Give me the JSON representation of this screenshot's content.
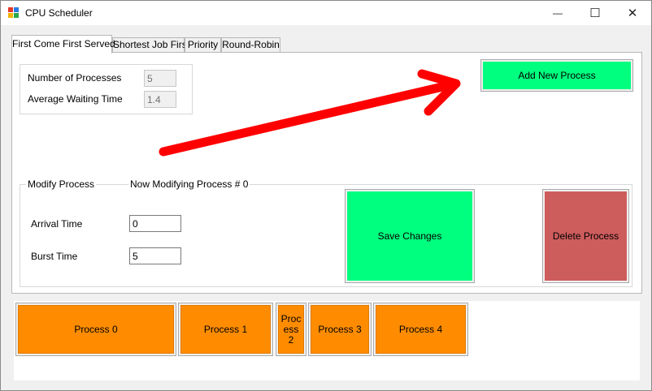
{
  "window": {
    "title": "CPU Scheduler",
    "icon": "app-window-icon",
    "controls": {
      "minimize": "—",
      "maximize": "☐",
      "close": "✕"
    }
  },
  "tabs": [
    {
      "label": "First Come First Served",
      "active": true
    },
    {
      "label": "Shortest Job First",
      "active": false
    },
    {
      "label": "Priority",
      "active": false
    },
    {
      "label": "Round-Robin",
      "active": false
    }
  ],
  "stats": {
    "num_processes_label": "Number of Processes",
    "num_processes_value": "5",
    "avg_wait_label": "Average Waiting Time",
    "avg_wait_value": "1.4"
  },
  "add_button": {
    "label": "Add New Process",
    "color": "#00ff7f"
  },
  "modify": {
    "group_title": "Modify Process",
    "status": "Now Modifying Process # 0",
    "arrival_label": "Arrival Time",
    "arrival_value": "0",
    "burst_label": "Burst Time",
    "burst_value": "5",
    "save_label": "Save Changes",
    "save_color": "#00ff7f",
    "delete_label": "Delete Process",
    "delete_color": "#cd5c5c"
  },
  "processes": [
    {
      "label": "Process 0",
      "color": "#ff8c00"
    },
    {
      "label": "Process 1",
      "color": "#ff8c00"
    },
    {
      "label": "Proc ess 2",
      "color": "#ff8c00"
    },
    {
      "label": "Process 3",
      "color": "#ff8c00"
    },
    {
      "label": "Process 4",
      "color": "#ff8c00"
    }
  ]
}
